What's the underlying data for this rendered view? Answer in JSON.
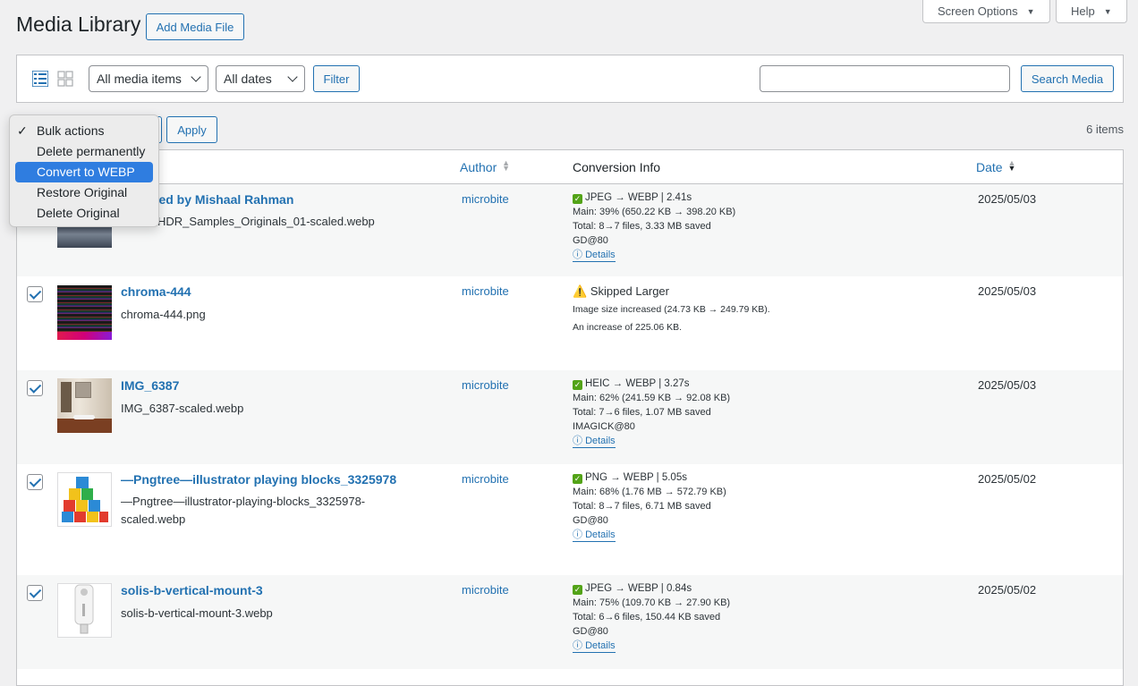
{
  "header": {
    "title": "Media Library",
    "add_button": "Add Media File",
    "screen_options": "Screen Options",
    "help": "Help"
  },
  "filters": {
    "media_type": "All media items",
    "dates": "All dates",
    "filter_button": "Filter",
    "search_button": "Search Media",
    "search_value": ""
  },
  "bulk": {
    "options": [
      "Bulk actions",
      "Delete permanently",
      "Convert to WEBP",
      "Restore Original",
      "Delete Original"
    ],
    "checked": "Bulk actions",
    "highlighted": "Convert to WEBP",
    "apply": "Apply",
    "items_count": "6 items"
  },
  "columns": {
    "author": "Author",
    "conversion": "Conversion Info",
    "date": "Date"
  },
  "rows": [
    {
      "title": "Captured by Mishaal Rahman",
      "visible_title": "red by Mishaal Rahman",
      "file": "HDR_Samples_Originals_01-scaled.webp",
      "visible_file": "HDR_Samples_Originals_01-scaled.webp",
      "author": "microbite",
      "conv": [
        "JPEG → WEBP | 2.41s",
        "Main: 39% (650.22 KB → 398.20 KB)",
        "Total: 8→7 files, 3.33 MB saved",
        "GD@80"
      ],
      "details": "Details",
      "date": "2025/05/03"
    },
    {
      "title": "chroma-444",
      "file": "chroma-444.png",
      "author": "microbite",
      "skipped": "Skipped Larger",
      "skipped_lines": [
        "Image size increased (24.73 KB → 249.79 KB).",
        "An increase of 225.06 KB."
      ],
      "date": "2025/05/03"
    },
    {
      "title": "IMG_6387",
      "file": "IMG_6387-scaled.webp",
      "author": "microbite",
      "conv": [
        "HEIC → WEBP | 3.27s",
        "Main: 62% (241.59 KB → 92.08 KB)",
        "Total: 7→6 files, 1.07 MB saved",
        "IMAGICK@80"
      ],
      "details": "Details",
      "date": "2025/05/03"
    },
    {
      "title": "—Pngtree—illustrator playing blocks_3325978",
      "file": "—Pngtree—illustrator-playing-blocks_3325978-scaled.webp",
      "author": "microbite",
      "conv": [
        "PNG → WEBP | 5.05s",
        "Main: 68% (1.76 MB → 572.79 KB)",
        "Total: 8→7 files, 6.71 MB saved",
        "GD@80"
      ],
      "details": "Details",
      "date": "2025/05/02"
    },
    {
      "title": "solis-b-vertical-mount-3",
      "file": "solis-b-vertical-mount-3.webp",
      "author": "microbite",
      "conv": [
        "JPEG → WEBP | 0.84s",
        "Main: 75% (109.70 KB → 27.90 KB)",
        "Total: 6→6 files, 150.44 KB saved",
        "GD@80"
      ],
      "details": "Details",
      "date": "2025/05/02"
    }
  ],
  "colors": {
    "link": "#2271b1",
    "selected": "#2f7de0",
    "check": "#53a318"
  }
}
